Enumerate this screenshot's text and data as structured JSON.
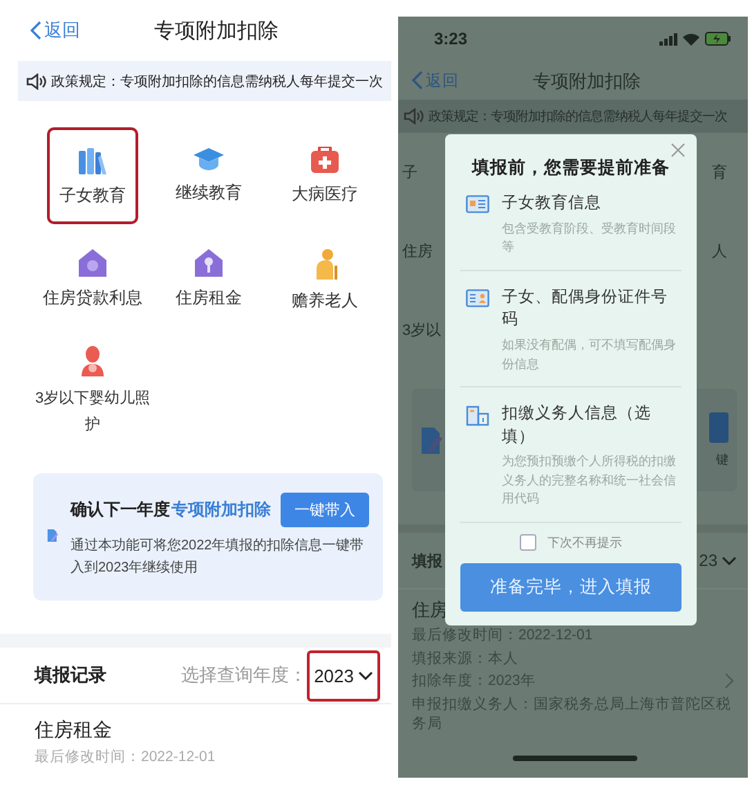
{
  "left_screen": {
    "header": {
      "back": "返回",
      "title": "专项附加扣除"
    },
    "notice": "政策规定：专项附加扣除的信息需纳税人每年提交一次",
    "categories": [
      {
        "label": "子女教育",
        "kind": "books",
        "highlighted": true
      },
      {
        "label": "继续教育",
        "kind": "cap",
        "highlighted": false
      },
      {
        "label": "大病医疗",
        "kind": "medkit",
        "highlighted": false
      },
      {
        "label": "住房贷款利息",
        "kind": "house",
        "highlighted": false
      },
      {
        "label": "住房租金",
        "kind": "key",
        "highlighted": false
      },
      {
        "label": "赡养老人",
        "kind": "elder",
        "highlighted": false
      },
      {
        "label": "3岁以下婴幼儿照护",
        "kind": "mother",
        "highlighted": false
      }
    ],
    "banner": {
      "title": "确认下一年度",
      "title_link": "专项附加扣除",
      "button": "一键带入",
      "text": "通过本功能可将您2022年填报的扣除信息一键带入到2023年继续使用"
    },
    "records": {
      "title": "填报记录",
      "year_label": "选择查询年度：",
      "year": "2023",
      "year_highlighted": true,
      "items": [
        {
          "name": "住房租金",
          "modified": "最后修改时间：2022-12-01"
        }
      ]
    }
  },
  "right_screen": {
    "status_bar": {
      "time": "3:23"
    },
    "header": {
      "back": "返回",
      "title": "专项附加扣除"
    },
    "notice": "政策规定：专项附加扣除的信息需纳税人每年提交一次",
    "peek_rows": [
      {
        "left": "子",
        "right": "育"
      },
      {
        "left": "住房",
        "right": "人"
      },
      {
        "left": "3岁以"
      }
    ],
    "banner_peek": {
      "text": "键"
    },
    "records_peek": {
      "title": "填报",
      "year": "23"
    },
    "record": {
      "name": "住房",
      "lines": [
        "最后修改时间：2022-12-01",
        "填报来源：本人",
        "扣除年度：2023年",
        "申报扣缴义务人：国家税务总局上海市普陀区税务局"
      ]
    },
    "dialog": {
      "title": "填报前，您需要提前准备",
      "items": [
        {
          "kind": "card",
          "title": "子女教育信息",
          "desc": "包含受教育阶段、受教育时间段等"
        },
        {
          "kind": "id",
          "title": "子女、配偶身份证件号码",
          "desc": "如果没有配偶，可不填写配偶身份信息"
        },
        {
          "kind": "building",
          "title": "扣缴义务人信息（选填）",
          "desc": "为您预扣预缴个人所得税的扣缴义务人的完整名称和统一社会信用代码"
        }
      ],
      "dont_remind": {
        "label": "下次不再提示",
        "checked": false
      },
      "button": "准备完毕，进入填报"
    }
  }
}
